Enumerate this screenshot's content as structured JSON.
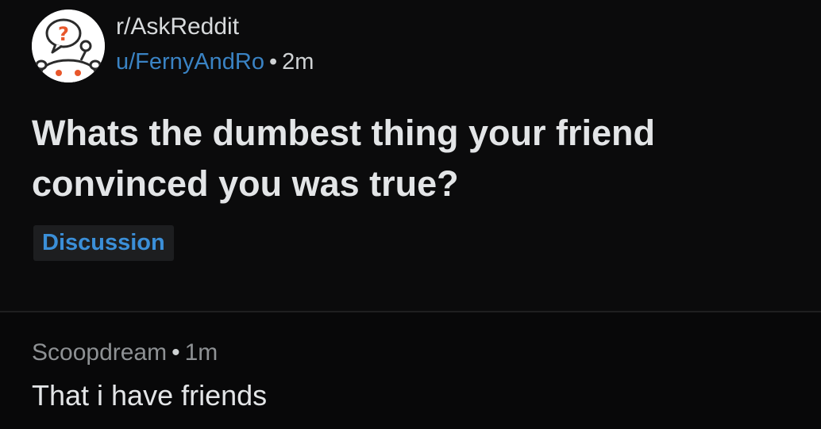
{
  "post": {
    "subreddit": "r/AskReddit",
    "author": "u/FernyAndRo",
    "separator": "•",
    "age": "2m",
    "avatar_icon": "reddit-question-snoo-icon",
    "title": "Whats the dumbest thing your friend convinced you was true?",
    "flair": "Discussion"
  },
  "comment": {
    "author": "Scoopdream",
    "separator": "•",
    "age": "1m",
    "body": "That i have friends"
  },
  "colors": {
    "background": "#000000",
    "author_link": "#3a83c4",
    "flair_text": "#3b8fd8",
    "avatar_accent": "#e8572b"
  }
}
